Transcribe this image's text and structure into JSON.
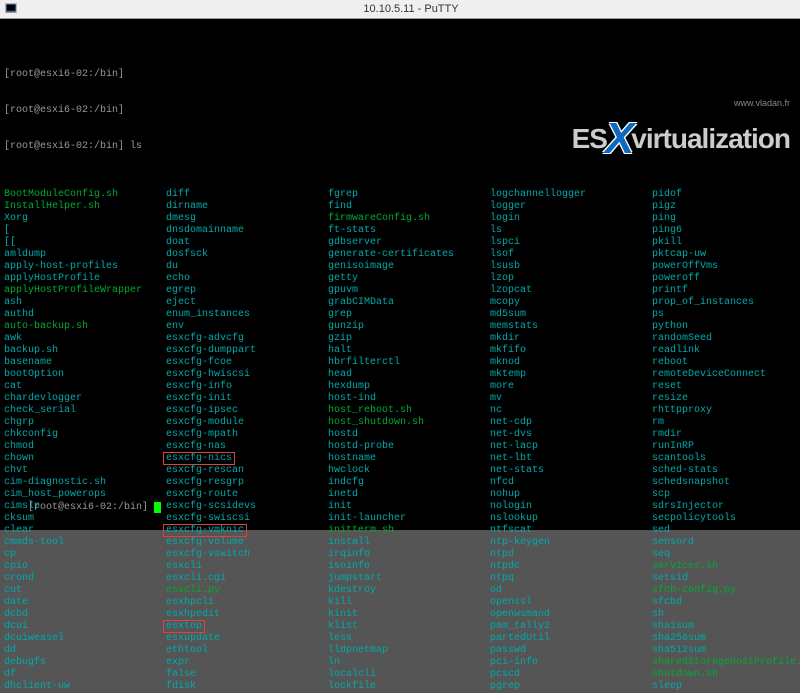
{
  "window": {
    "title": "10.10.5.11 - PuTTY"
  },
  "watermark": {
    "text1": "ES",
    "text2": "virtualization",
    "url": "www.vladan.fr"
  },
  "prompts": [
    "[root@esxi6-02:/bin]",
    "[root@esxi6-02:/bin]",
    "[root@esxi6-02:/bin] ls"
  ],
  "bottom_prompt": "[root@esxi6-02:/bin] ",
  "listing": {
    "cols": [
      [
        {
          "t": "BootModuleConfig.sh",
          "c": "green"
        },
        {
          "t": "InstallHelper.sh",
          "c": "green"
        },
        {
          "t": "Xorg",
          "c": "teal"
        },
        {
          "t": "[",
          "c": "teal"
        },
        {
          "t": "[[",
          "c": "teal"
        },
        {
          "t": "amldump",
          "c": "teal"
        },
        {
          "t": "apply-host-profiles",
          "c": "teal"
        },
        {
          "t": "applyHostProfile",
          "c": "teal"
        },
        {
          "t": "applyHostProfileWrapper",
          "c": "green"
        },
        {
          "t": "ash",
          "c": "teal"
        },
        {
          "t": "authd",
          "c": "teal"
        },
        {
          "t": "auto-backup.sh",
          "c": "green"
        },
        {
          "t": "awk",
          "c": "teal"
        },
        {
          "t": "backup.sh",
          "c": "teal"
        },
        {
          "t": "basename",
          "c": "teal"
        },
        {
          "t": "bootOption",
          "c": "teal"
        },
        {
          "t": "cat",
          "c": "teal"
        },
        {
          "t": "chardevlogger",
          "c": "teal"
        },
        {
          "t": "check_serial",
          "c": "teal"
        },
        {
          "t": "chgrp",
          "c": "teal"
        },
        {
          "t": "chkconfig",
          "c": "teal"
        },
        {
          "t": "chmod",
          "c": "teal"
        },
        {
          "t": "chown",
          "c": "teal"
        },
        {
          "t": "chvt",
          "c": "teal"
        },
        {
          "t": "cim-diagnostic.sh",
          "c": "teal"
        },
        {
          "t": "cim_host_powerops",
          "c": "teal"
        },
        {
          "t": "cimslp",
          "c": "teal"
        },
        {
          "t": "cksum",
          "c": "teal"
        },
        {
          "t": "clear",
          "c": "teal"
        },
        {
          "t": "cmmds-tool",
          "c": "teal"
        },
        {
          "t": "cp",
          "c": "teal"
        },
        {
          "t": "cpio",
          "c": "teal"
        },
        {
          "t": "crond",
          "c": "teal"
        },
        {
          "t": "cut",
          "c": "teal"
        },
        {
          "t": "date",
          "c": "teal"
        },
        {
          "t": "dcbd",
          "c": "teal"
        },
        {
          "t": "dcui",
          "c": "teal"
        },
        {
          "t": "dcuiweasel",
          "c": "teal"
        },
        {
          "t": "dd",
          "c": "teal"
        },
        {
          "t": "debugfs",
          "c": "teal"
        },
        {
          "t": "df",
          "c": "teal"
        },
        {
          "t": "dhclient-uw",
          "c": "teal"
        }
      ],
      [
        {
          "t": "diff",
          "c": "teal"
        },
        {
          "t": "dirname",
          "c": "teal"
        },
        {
          "t": "dmesg",
          "c": "teal"
        },
        {
          "t": "dnsdomainname",
          "c": "teal"
        },
        {
          "t": "doat",
          "c": "teal"
        },
        {
          "t": "dosfsck",
          "c": "teal"
        },
        {
          "t": "du",
          "c": "teal"
        },
        {
          "t": "echo",
          "c": "teal"
        },
        {
          "t": "egrep",
          "c": "teal"
        },
        {
          "t": "eject",
          "c": "teal"
        },
        {
          "t": "enum_instances",
          "c": "teal"
        },
        {
          "t": "env",
          "c": "teal"
        },
        {
          "t": "esxcfg-advcfg",
          "c": "teal"
        },
        {
          "t": "esxcfg-dumppart",
          "c": "teal"
        },
        {
          "t": "esxcfg-fcoe",
          "c": "teal"
        },
        {
          "t": "esxcfg-hwiscsi",
          "c": "teal"
        },
        {
          "t": "esxcfg-info",
          "c": "teal"
        },
        {
          "t": "esxcfg-init",
          "c": "teal"
        },
        {
          "t": "esxcfg-ipsec",
          "c": "teal"
        },
        {
          "t": "esxcfg-module",
          "c": "teal"
        },
        {
          "t": "esxcfg-mpath",
          "c": "teal"
        },
        {
          "t": "esxcfg-nas",
          "c": "teal"
        },
        {
          "t": "esxcfg-nics",
          "c": "teal",
          "hl": true
        },
        {
          "t": "esxcfg-rescan",
          "c": "teal"
        },
        {
          "t": "esxcfg-resgrp",
          "c": "teal"
        },
        {
          "t": "esxcfg-route",
          "c": "teal"
        },
        {
          "t": "esxcfg-scsidevs",
          "c": "teal"
        },
        {
          "t": "esxcfg-swiscsi",
          "c": "teal"
        },
        {
          "t": "esxcfg-vmknic",
          "c": "teal",
          "hl": true
        },
        {
          "t": "esxcfg-volume",
          "c": "teal"
        },
        {
          "t": "esxcfg-vswitch",
          "c": "teal"
        },
        {
          "t": "esxcli",
          "c": "teal"
        },
        {
          "t": "esxcli.cgi",
          "c": "teal"
        },
        {
          "t": "esxcli.py",
          "c": "green"
        },
        {
          "t": "esxhpcli",
          "c": "teal"
        },
        {
          "t": "esxhpedit",
          "c": "teal"
        },
        {
          "t": "esxtop",
          "c": "teal",
          "hl": true
        },
        {
          "t": "esxupdate",
          "c": "teal"
        },
        {
          "t": "ethtool",
          "c": "teal"
        },
        {
          "t": "expr",
          "c": "teal"
        },
        {
          "t": "false",
          "c": "teal"
        },
        {
          "t": "fdisk",
          "c": "teal"
        }
      ],
      [
        {
          "t": "fgrep",
          "c": "teal"
        },
        {
          "t": "find",
          "c": "teal"
        },
        {
          "t": "firmwareConfig.sh",
          "c": "green"
        },
        {
          "t": "ft-stats",
          "c": "teal"
        },
        {
          "t": "gdbserver",
          "c": "teal"
        },
        {
          "t": "generate-certificates",
          "c": "teal"
        },
        {
          "t": "genisoimage",
          "c": "teal"
        },
        {
          "t": "getty",
          "c": "teal"
        },
        {
          "t": "gpuvm",
          "c": "teal"
        },
        {
          "t": "grabCIMData",
          "c": "teal"
        },
        {
          "t": "grep",
          "c": "teal"
        },
        {
          "t": "gunzip",
          "c": "teal"
        },
        {
          "t": "gzip",
          "c": "teal"
        },
        {
          "t": "halt",
          "c": "teal"
        },
        {
          "t": "hbrfilterctl",
          "c": "teal"
        },
        {
          "t": "head",
          "c": "teal"
        },
        {
          "t": "hexdump",
          "c": "teal"
        },
        {
          "t": "host-ind",
          "c": "teal"
        },
        {
          "t": "host_reboot.sh",
          "c": "green"
        },
        {
          "t": "host_shutdown.sh",
          "c": "green"
        },
        {
          "t": "hostd",
          "c": "teal"
        },
        {
          "t": "hostd-probe",
          "c": "teal"
        },
        {
          "t": "hostname",
          "c": "teal"
        },
        {
          "t": "hwclock",
          "c": "teal"
        },
        {
          "t": "indcfg",
          "c": "teal"
        },
        {
          "t": "inetd",
          "c": "teal"
        },
        {
          "t": "init",
          "c": "teal"
        },
        {
          "t": "init-launcher",
          "c": "teal"
        },
        {
          "t": "initterm.sh",
          "c": "green"
        },
        {
          "t": "install",
          "c": "teal"
        },
        {
          "t": "irqinfo",
          "c": "teal"
        },
        {
          "t": "isoinfo",
          "c": "teal"
        },
        {
          "t": "jumpstart",
          "c": "teal"
        },
        {
          "t": "kdestroy",
          "c": "teal"
        },
        {
          "t": "kill",
          "c": "teal"
        },
        {
          "t": "kinit",
          "c": "teal"
        },
        {
          "t": "klist",
          "c": "teal"
        },
        {
          "t": "less",
          "c": "teal"
        },
        {
          "t": "lldpnetmap",
          "c": "teal"
        },
        {
          "t": "ln",
          "c": "teal"
        },
        {
          "t": "localcli",
          "c": "teal"
        },
        {
          "t": "lockfile",
          "c": "teal"
        }
      ],
      [
        {
          "t": "logchannellogger",
          "c": "teal"
        },
        {
          "t": "logger",
          "c": "teal"
        },
        {
          "t": "login",
          "c": "teal"
        },
        {
          "t": "ls",
          "c": "teal"
        },
        {
          "t": "lspci",
          "c": "teal"
        },
        {
          "t": "lsof",
          "c": "teal"
        },
        {
          "t": "lsusb",
          "c": "teal"
        },
        {
          "t": "lzop",
          "c": "teal"
        },
        {
          "t": "lzopcat",
          "c": "teal"
        },
        {
          "t": "mcopy",
          "c": "teal"
        },
        {
          "t": "md5sum",
          "c": "teal"
        },
        {
          "t": "memstats",
          "c": "teal"
        },
        {
          "t": "mkdir",
          "c": "teal"
        },
        {
          "t": "mkfifo",
          "c": "teal"
        },
        {
          "t": "mknod",
          "c": "teal"
        },
        {
          "t": "mktemp",
          "c": "teal"
        },
        {
          "t": "more",
          "c": "teal"
        },
        {
          "t": "mv",
          "c": "teal"
        },
        {
          "t": "nc",
          "c": "teal"
        },
        {
          "t": "net-cdp",
          "c": "teal"
        },
        {
          "t": "net-dvs",
          "c": "teal"
        },
        {
          "t": "net-lacp",
          "c": "teal"
        },
        {
          "t": "net-lbt",
          "c": "teal"
        },
        {
          "t": "net-stats",
          "c": "teal"
        },
        {
          "t": "nfcd",
          "c": "teal"
        },
        {
          "t": "nohup",
          "c": "teal"
        },
        {
          "t": "nologin",
          "c": "teal"
        },
        {
          "t": "nslookup",
          "c": "teal"
        },
        {
          "t": "ntfscat",
          "c": "teal"
        },
        {
          "t": "ntp-keygen",
          "c": "teal"
        },
        {
          "t": "ntpd",
          "c": "teal"
        },
        {
          "t": "ntpdc",
          "c": "teal"
        },
        {
          "t": "ntpq",
          "c": "teal"
        },
        {
          "t": "od",
          "c": "teal"
        },
        {
          "t": "openssl",
          "c": "teal"
        },
        {
          "t": "openwsmand",
          "c": "teal"
        },
        {
          "t": "pam_tally2",
          "c": "teal"
        },
        {
          "t": "partedUtil",
          "c": "teal"
        },
        {
          "t": "passwd",
          "c": "teal"
        },
        {
          "t": "pci-info",
          "c": "teal"
        },
        {
          "t": "pcscd",
          "c": "teal"
        },
        {
          "t": "pgrep",
          "c": "teal"
        }
      ],
      [
        {
          "t": "pidof",
          "c": "teal"
        },
        {
          "t": "pigz",
          "c": "teal"
        },
        {
          "t": "ping",
          "c": "teal"
        },
        {
          "t": "ping6",
          "c": "teal"
        },
        {
          "t": "pkill",
          "c": "teal"
        },
        {
          "t": "pktcap-uw",
          "c": "teal"
        },
        {
          "t": "powerOffVms",
          "c": "teal"
        },
        {
          "t": "poweroff",
          "c": "teal"
        },
        {
          "t": "printf",
          "c": "teal"
        },
        {
          "t": "prop_of_instances",
          "c": "teal"
        },
        {
          "t": "ps",
          "c": "teal"
        },
        {
          "t": "python",
          "c": "teal"
        },
        {
          "t": "randomSeed",
          "c": "teal"
        },
        {
          "t": "readlink",
          "c": "teal"
        },
        {
          "t": "reboot",
          "c": "teal"
        },
        {
          "t": "remoteDeviceConnect",
          "c": "teal"
        },
        {
          "t": "reset",
          "c": "teal"
        },
        {
          "t": "resize",
          "c": "teal"
        },
        {
          "t": "rhttpproxy",
          "c": "teal"
        },
        {
          "t": "rm",
          "c": "teal"
        },
        {
          "t": "rmdir",
          "c": "teal"
        },
        {
          "t": "runInRP",
          "c": "teal"
        },
        {
          "t": "scantools",
          "c": "teal"
        },
        {
          "t": "sched-stats",
          "c": "teal"
        },
        {
          "t": "schedsnapshot",
          "c": "teal"
        },
        {
          "t": "scp",
          "c": "teal"
        },
        {
          "t": "sdrsInjector",
          "c": "teal"
        },
        {
          "t": "secpolicytools",
          "c": "teal"
        },
        {
          "t": "sed",
          "c": "teal"
        },
        {
          "t": "sensord",
          "c": "teal"
        },
        {
          "t": "seq",
          "c": "teal"
        },
        {
          "t": "services.sh",
          "c": "green"
        },
        {
          "t": "setsid",
          "c": "teal"
        },
        {
          "t": "sfcb-config.py",
          "c": "green"
        },
        {
          "t": "sfcbd",
          "c": "teal"
        },
        {
          "t": "sh",
          "c": "teal"
        },
        {
          "t": "sha1sum",
          "c": "teal"
        },
        {
          "t": "sha256sum",
          "c": "teal"
        },
        {
          "t": "sha512sum",
          "c": "teal"
        },
        {
          "t": "sharedStorageHostProfile.sh",
          "c": "green"
        },
        {
          "t": "shutdown.sh",
          "c": "green"
        },
        {
          "t": "sleep",
          "c": "teal"
        }
      ]
    ]
  }
}
